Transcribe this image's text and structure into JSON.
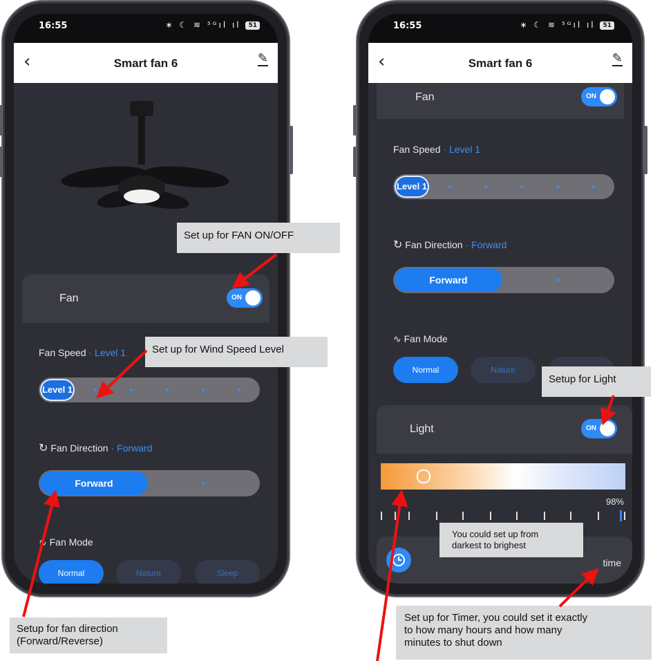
{
  "left_phone": {
    "status_time": "16:55",
    "status_icons": "∗ ☾ ≋ ⁵ᴳıl ıl",
    "battery": "51",
    "header": {
      "back_icon": "chevron-left-icon",
      "title": "Smart fan 6",
      "edit_icon": "pencil-icon"
    },
    "fan_card": {
      "label": "Fan",
      "toggle_text": "ON",
      "on": true
    },
    "fan_speed": {
      "label": "Fan Speed",
      "separator": "·",
      "value": "Level 1",
      "slider_label": "Level 1",
      "level": 1,
      "levels": 6
    },
    "fan_direction": {
      "label": "Fan Direction",
      "separator": "·",
      "value": "Forward",
      "button": "Forward"
    },
    "fan_mode": {
      "label": "Fan Mode",
      "options": [
        "Normal",
        "Nature",
        "Sleep"
      ],
      "selected": "Normal"
    }
  },
  "right_phone": {
    "status_time": "16:55",
    "status_icons": "∗ ☾ ≋ ⁵ᴳıl ıl",
    "battery": "51",
    "header": {
      "back_icon": "chevron-left-icon",
      "title": "Smart fan 6",
      "edit_icon": "pencil-icon"
    },
    "fan_card": {
      "label": "Fan",
      "toggle_text": "ON",
      "on": true
    },
    "fan_speed": {
      "label": "Fan Speed",
      "separator": "·",
      "value": "Level 1",
      "slider_label": "Level 1",
      "level": 1,
      "levels": 6
    },
    "fan_direction": {
      "label": "Fan Direction",
      "separator": "·",
      "value": "Forward",
      "button": "Forward"
    },
    "fan_mode": {
      "label": "Fan Mode",
      "options": [
        "Normal",
        "Nature"
      ],
      "selected": "Normal"
    },
    "light_card": {
      "label": "Light",
      "toggle_text": "ON",
      "on": true
    },
    "brightness": {
      "percent_text": "98%",
      "value": 98
    },
    "timer": {
      "label": "time",
      "icon": "clock-icon"
    }
  },
  "annotations": {
    "fan_on_off": "Set up for FAN ON/OFF",
    "wind_speed": "Set up for Wind Speed Level",
    "fan_direction_line1": "Setup for fan direction",
    "fan_direction_line2": "(Forward/Reverse)",
    "light": "Setup for Light",
    "brightness_line1": "You could set up from",
    "brightness_line2": "darkest to brighest",
    "timer_line1": "Set up for Timer, you could set it exactly",
    "timer_line2": "to how many hours and how many",
    "timer_line3": "minutes to shut down"
  },
  "colors": {
    "accent": "#2f8af6",
    "panel": "#2e2f36",
    "card": "#3b3c43",
    "arrow": "#ee1111"
  }
}
